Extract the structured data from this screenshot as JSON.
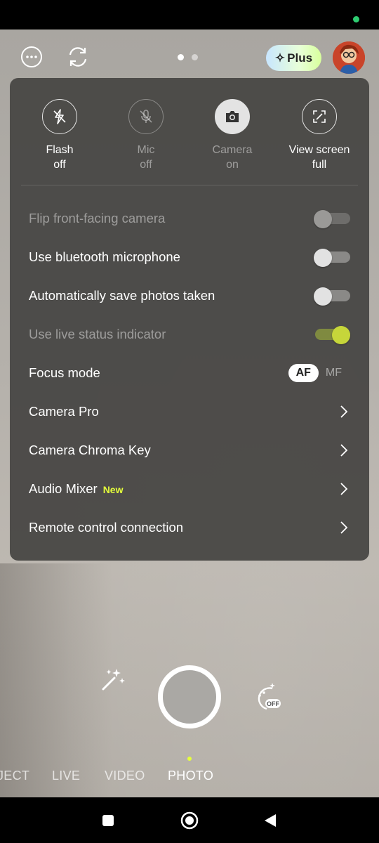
{
  "top_bar": {
    "plus_label": "Plus"
  },
  "quick_toggles": [
    {
      "line1": "Flash",
      "line2": "off",
      "icon": "flash-off-icon"
    },
    {
      "line1": "Mic",
      "line2": "off",
      "icon": "mic-off-icon"
    },
    {
      "line1": "Camera",
      "line2": "on",
      "icon": "camera-icon"
    },
    {
      "line1": "View screen",
      "line2": "full",
      "icon": "fullscreen-icon"
    }
  ],
  "settings": [
    {
      "label": "Flip front-facing camera",
      "type": "toggle",
      "state": "off",
      "enabled": false
    },
    {
      "label": "Use bluetooth microphone",
      "type": "toggle",
      "state": "off",
      "enabled": true
    },
    {
      "label": "Automatically save photos taken",
      "type": "toggle",
      "state": "off",
      "enabled": true
    },
    {
      "label": "Use live status indicator",
      "type": "toggle",
      "state": "on",
      "enabled": false
    },
    {
      "label": "Focus mode",
      "type": "segmented",
      "options": [
        "AF",
        "MF"
      ],
      "selected": "AF"
    },
    {
      "label": "Camera Pro",
      "type": "link"
    },
    {
      "label": "Camera Chroma Key",
      "type": "link"
    },
    {
      "label": "Audio Mixer",
      "badge": "New",
      "type": "link"
    },
    {
      "label": "Remote control connection",
      "type": "link"
    }
  ],
  "modes": {
    "items": [
      "JECT",
      "LIVE",
      "VIDEO",
      "PHOTO"
    ],
    "active": "PHOTO"
  },
  "colors": {
    "accent": "#e6ff3b",
    "panel": "#484745",
    "status_dot": "#2ecc71"
  }
}
